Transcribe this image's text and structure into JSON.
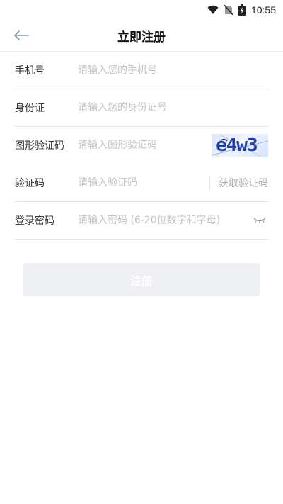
{
  "status_bar": {
    "time": "10:55",
    "icons": [
      "wifi-icon",
      "no-sim-icon",
      "battery-charging-icon"
    ]
  },
  "nav": {
    "back_icon": "arrow-left-icon",
    "title": "立即注册"
  },
  "form": {
    "phone": {
      "label": "手机号",
      "placeholder": "请输入您的手机号",
      "value": ""
    },
    "id_card": {
      "label": "身份证",
      "placeholder": "请输入您的身份证号",
      "value": ""
    },
    "captcha": {
      "label": "图形验证码",
      "placeholder": "请输入图形验证码",
      "value": "",
      "image_text": "e4w3"
    },
    "sms_code": {
      "label": "验证码",
      "placeholder": "请输入验证码",
      "value": "",
      "get_code_label": "获取验证码"
    },
    "password": {
      "label": "登录密码",
      "placeholder": "请输入密码 (6-20位数字和字母)",
      "value": "",
      "toggle_icon": "eye-closed-icon"
    }
  },
  "submit": {
    "label": "注册"
  },
  "colors": {
    "accent_back": "#7f9ab6",
    "placeholder": "#c4c4c4",
    "button_bg": "#eef0f4",
    "captcha_text": "#2141a8"
  }
}
